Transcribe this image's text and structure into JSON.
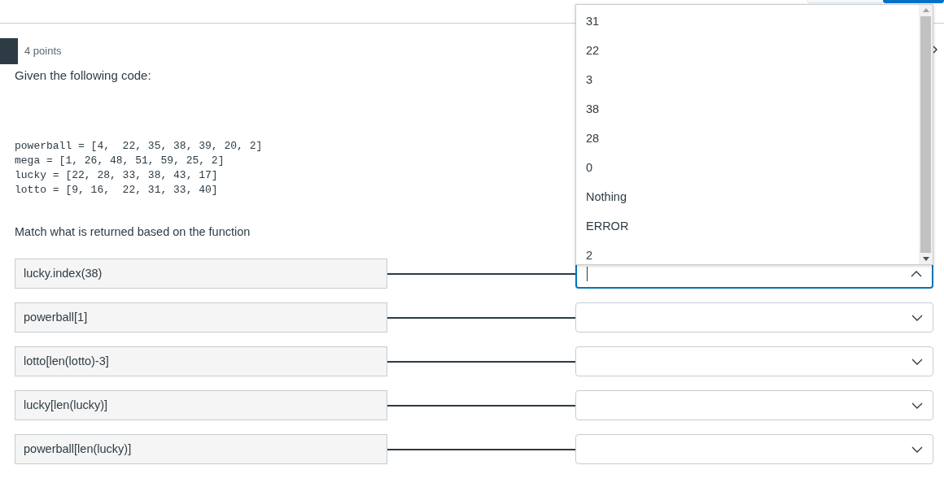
{
  "question": {
    "points": "4 points",
    "prompt": "Given the following code:",
    "code": [
      "powerball = [4,  22, 35, 38, 39, 20, 2]",
      "mega = [1, 26, 48, 51, 59, 25, 2]",
      "lucky = [22, 28, 33, 38, 43, 17]",
      "lotto = [9, 16,  22, 31, 33, 40]"
    ],
    "instruction": "Match what is returned based on the function"
  },
  "matches": [
    {
      "prompt": "lucky.index(38)",
      "expanded": true
    },
    {
      "prompt": "powerball[1]",
      "expanded": false
    },
    {
      "prompt": "lotto[len(lotto)-3]",
      "expanded": false
    },
    {
      "prompt": "lucky[len(lucky)]",
      "expanded": false
    },
    {
      "prompt": "powerball[len(lucky)]",
      "expanded": false
    }
  ],
  "dropdown": {
    "options": [
      "31",
      "22",
      "3",
      "38",
      "28",
      "0",
      "Nothing",
      "ERROR",
      "2"
    ]
  }
}
